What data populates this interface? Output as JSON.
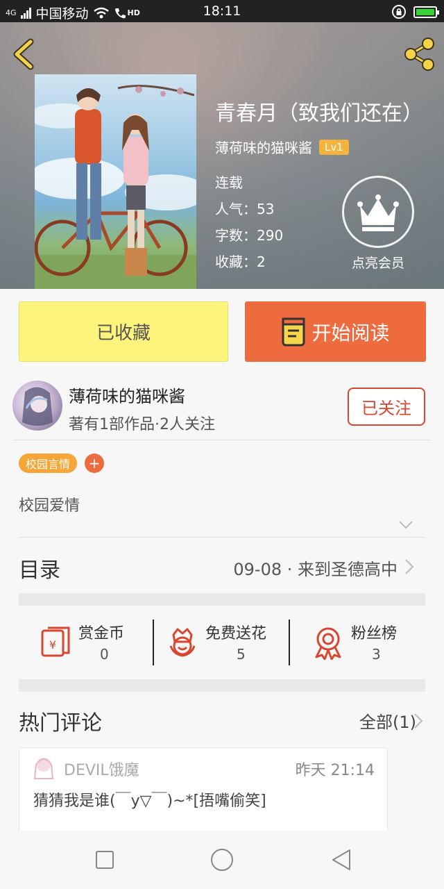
{
  "status_bar": {
    "network": "4G",
    "carrier": "中国移动",
    "hd": "HD",
    "time": "18:11"
  },
  "book": {
    "title": "青春月（致我们还在）",
    "author": "薄荷味的猫咪酱",
    "level": "Lv1",
    "status": "连载",
    "popularity_label": "人气：",
    "popularity": "53",
    "words_label": "字数：",
    "words": "290",
    "favorites_label": "收藏：",
    "favorites": "2",
    "vip_label": "点亮会员"
  },
  "actions": {
    "favorite_label": "已收藏",
    "read_label": "开始阅读"
  },
  "author_card": {
    "name": "薄荷味的猫咪酱",
    "stats": "著有1部作品·2人关注",
    "follow_label": "已关注"
  },
  "tags": {
    "items": [
      "校园言情"
    ],
    "add": "+"
  },
  "description": "校园爱情",
  "catalog": {
    "label": "目录",
    "latest": "09-08 · 来到圣德高中"
  },
  "stats": [
    {
      "label": "赏金币",
      "value": "0",
      "icon": "red-envelope-icon"
    },
    {
      "label": "免费送花",
      "value": "5",
      "icon": "flower-icon"
    },
    {
      "label": "粉丝榜",
      "value": "3",
      "icon": "medal-icon"
    }
  ],
  "comments": {
    "title": "热门评论",
    "all_label": "全部(1)",
    "items": [
      {
        "user": "DEVIL饿魔",
        "time": "昨天 21:14",
        "text": "猜猜我是谁(￣y▽￣)~*[捂嘴偷笑]"
      }
    ]
  },
  "colors": {
    "accent_orange": "#ee6a3f",
    "favorite_yellow": "#fdf47b",
    "tag_orange": "#f6a536",
    "follow_red": "#d9452e",
    "icon_red": "#d9452e",
    "back_yellow": "#f5d24a"
  }
}
